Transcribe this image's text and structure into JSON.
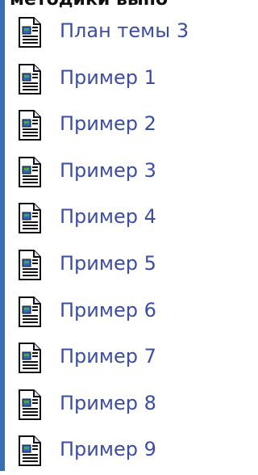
{
  "header_cut_text": "методики выпо",
  "items": [
    {
      "label": "План темы 3",
      "icon": "document-icon"
    },
    {
      "label": "Пример 1",
      "icon": "document-icon"
    },
    {
      "label": "Пример 2",
      "icon": "document-icon"
    },
    {
      "label": "Пример 3",
      "icon": "document-icon"
    },
    {
      "label": "Пример 4",
      "icon": "document-icon"
    },
    {
      "label": "Пример 5",
      "icon": "document-icon"
    },
    {
      "label": "Пример 6",
      "icon": "document-icon"
    },
    {
      "label": "Пример 7",
      "icon": "document-icon"
    },
    {
      "label": "Пример 8",
      "icon": "document-icon"
    },
    {
      "label": "Пример 9",
      "icon": "document-icon"
    }
  ],
  "colors": {
    "link": "#3d4da0",
    "rail": "#3b6db3",
    "background": "#ffffff"
  }
}
